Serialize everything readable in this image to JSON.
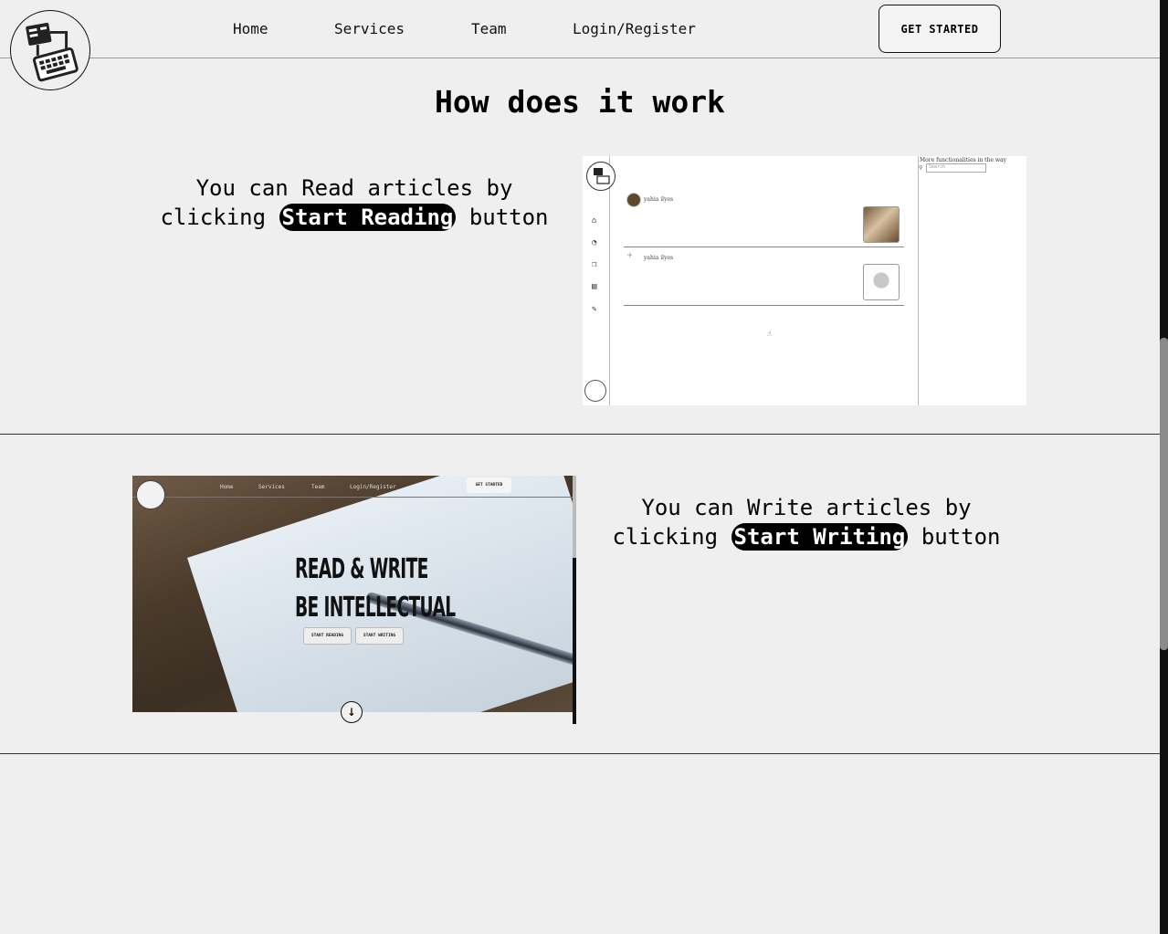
{
  "nav": {
    "items": [
      "Home",
      "Services",
      "Team",
      "Login/Register"
    ],
    "cta_label": "GET STARTED"
  },
  "section": {
    "title": "How does it work",
    "read": {
      "pre": "You can Read articles by",
      "pre2": "clicking",
      "button": "Start Reading",
      "post": "button"
    },
    "write": {
      "pre": "You can Write articles by",
      "pre2": "clicking",
      "button": "Start Writing",
      "post": "button"
    }
  },
  "shot1": {
    "side_note": "More functionalities in the way",
    "search_placeholder": "Search",
    "posts": [
      {
        "author": "yahia ilyes"
      },
      {
        "author": "yahia ilyes"
      }
    ]
  },
  "shot2": {
    "nav": [
      "Home",
      "Services",
      "Team",
      "Login/Register"
    ],
    "cta": "GET STARTED",
    "headline1": "READ & WRITE",
    "headline2": "BE INTELLECTUAL",
    "btn_read": "START READING",
    "btn_write": "START WRITING"
  }
}
